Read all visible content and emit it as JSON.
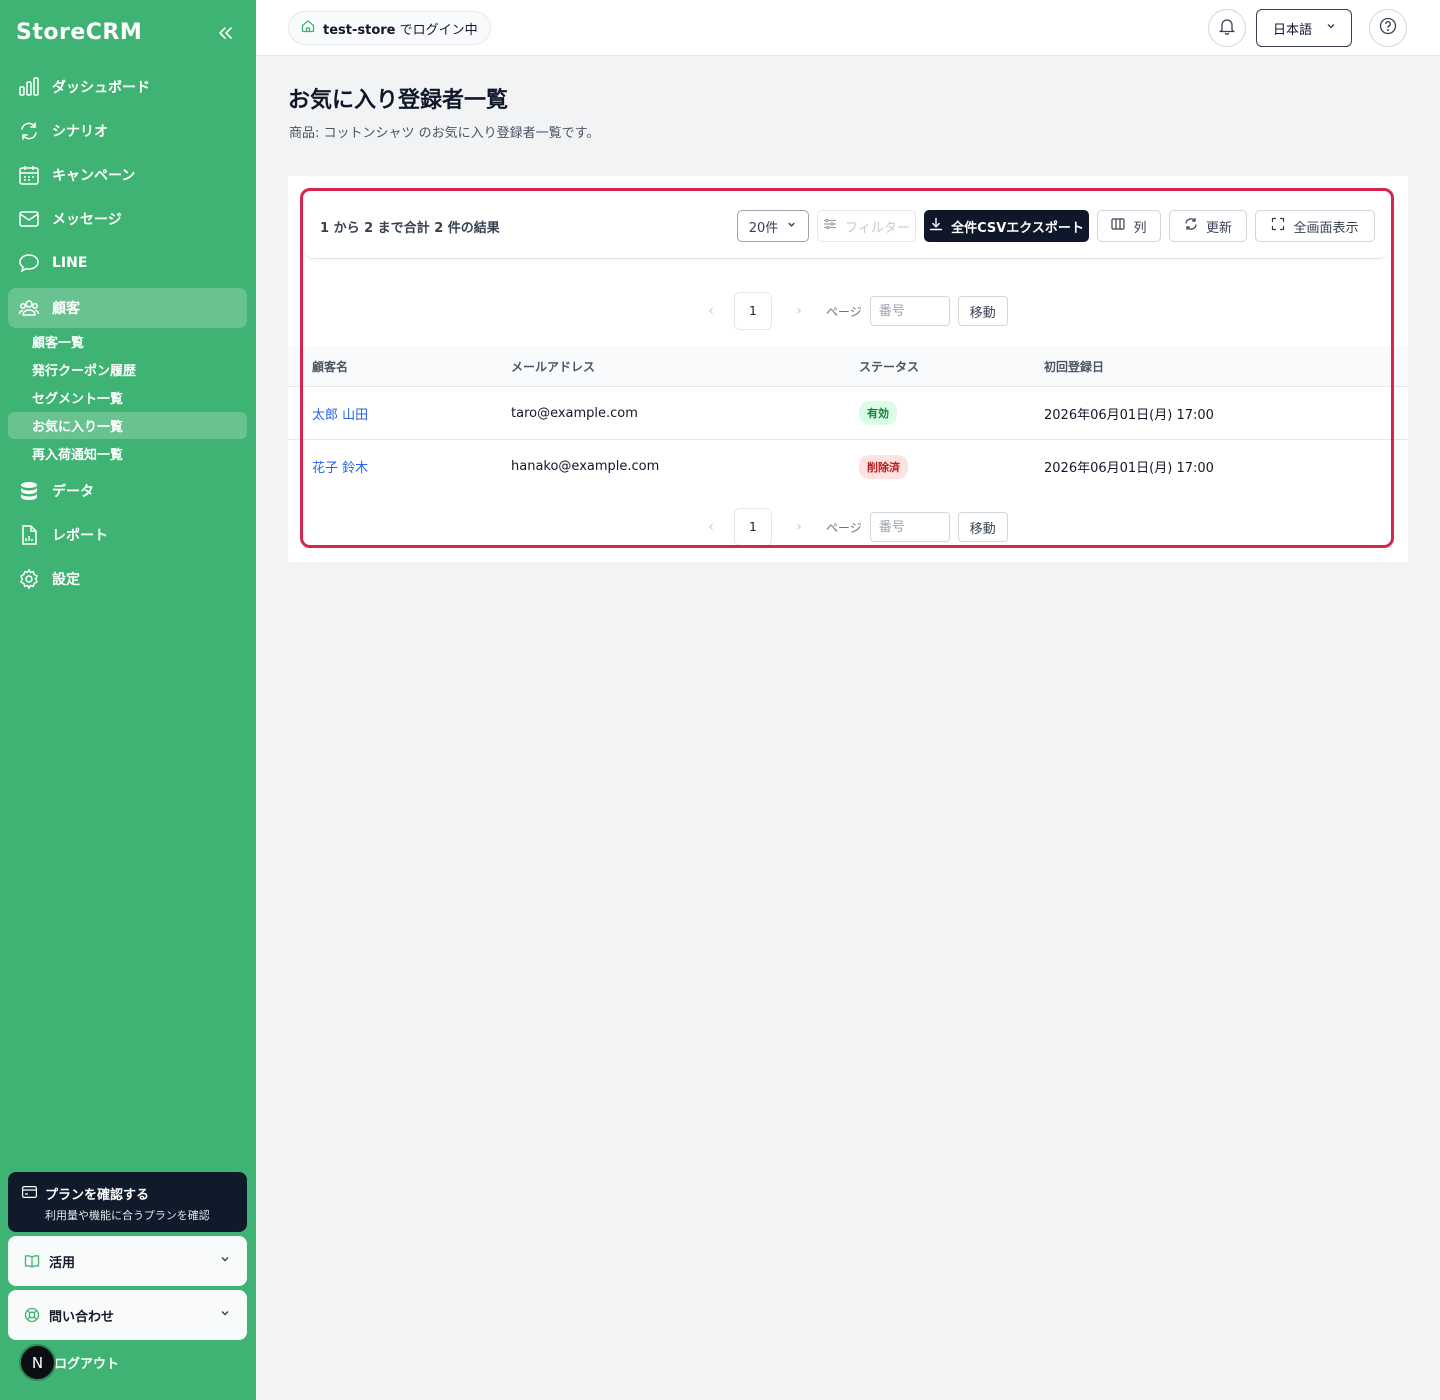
{
  "app": {
    "name": "StoreCRM"
  },
  "sidebar": {
    "nav": [
      {
        "label": "ダッシュボード",
        "icon": "chart-bar-icon"
      },
      {
        "label": "シナリオ",
        "icon": "refresh-icon"
      },
      {
        "label": "キャンペーン",
        "icon": "calendar-icon"
      },
      {
        "label": "メッセージ",
        "icon": "mail-icon"
      },
      {
        "label": "LINE",
        "icon": "chat-bubble-icon"
      },
      {
        "label": "顧客",
        "icon": "users-icon"
      },
      {
        "label": "データ",
        "icon": "database-icon"
      },
      {
        "label": "レポート",
        "icon": "report-icon"
      },
      {
        "label": "設定",
        "icon": "gear-icon"
      }
    ],
    "customer_sub": [
      {
        "label": "顧客一覧"
      },
      {
        "label": "発行クーポン履歴"
      },
      {
        "label": "セグメント一覧"
      },
      {
        "label": "お気に入り一覧"
      },
      {
        "label": "再入荷通知一覧"
      }
    ],
    "plan": {
      "title": "プランを確認する",
      "subtitle": "利用量や機能に合うプランを確認"
    },
    "accordion": [
      {
        "label": "活用"
      },
      {
        "label": "問い合わせ"
      }
    ],
    "user": {
      "initial": "N",
      "logout_label": "ログアウト"
    }
  },
  "header": {
    "store_name": "test-store",
    "store_suffix": "でログイン中",
    "language": "日本語"
  },
  "page": {
    "title": "お気に入り登録者一覧",
    "description": "商品: コットンシャツ のお気に入り登録者一覧です。"
  },
  "toolbar": {
    "result_text": "1 から 2 まで合計 2 件の結果",
    "page_size": "20件",
    "filter_label": "フィルター",
    "export_label": "全件CSVエクスポート",
    "columns_label": "列",
    "refresh_label": "更新",
    "fullscreen_label": "全画面表示"
  },
  "pagination": {
    "current_page": "1",
    "page_label": "ページ",
    "input_placeholder": "番号",
    "go_label": "移動"
  },
  "table": {
    "headers": [
      "顧客名",
      "メールアドレス",
      "ステータス",
      "初回登録日"
    ],
    "rows": [
      {
        "name": "太郎 山田",
        "email": "taro@example.com",
        "status": "有効",
        "registered": "2026年06月01日(月) 17:00"
      },
      {
        "name": "花子 鈴木",
        "email": "hanako@example.com",
        "status": "削除済",
        "registered": "2026年06月01日(月) 17:00"
      }
    ]
  },
  "colors": {
    "sidebar": "#3fb373",
    "highlight": "#d6264f",
    "primary_dark": "#0f172a"
  }
}
